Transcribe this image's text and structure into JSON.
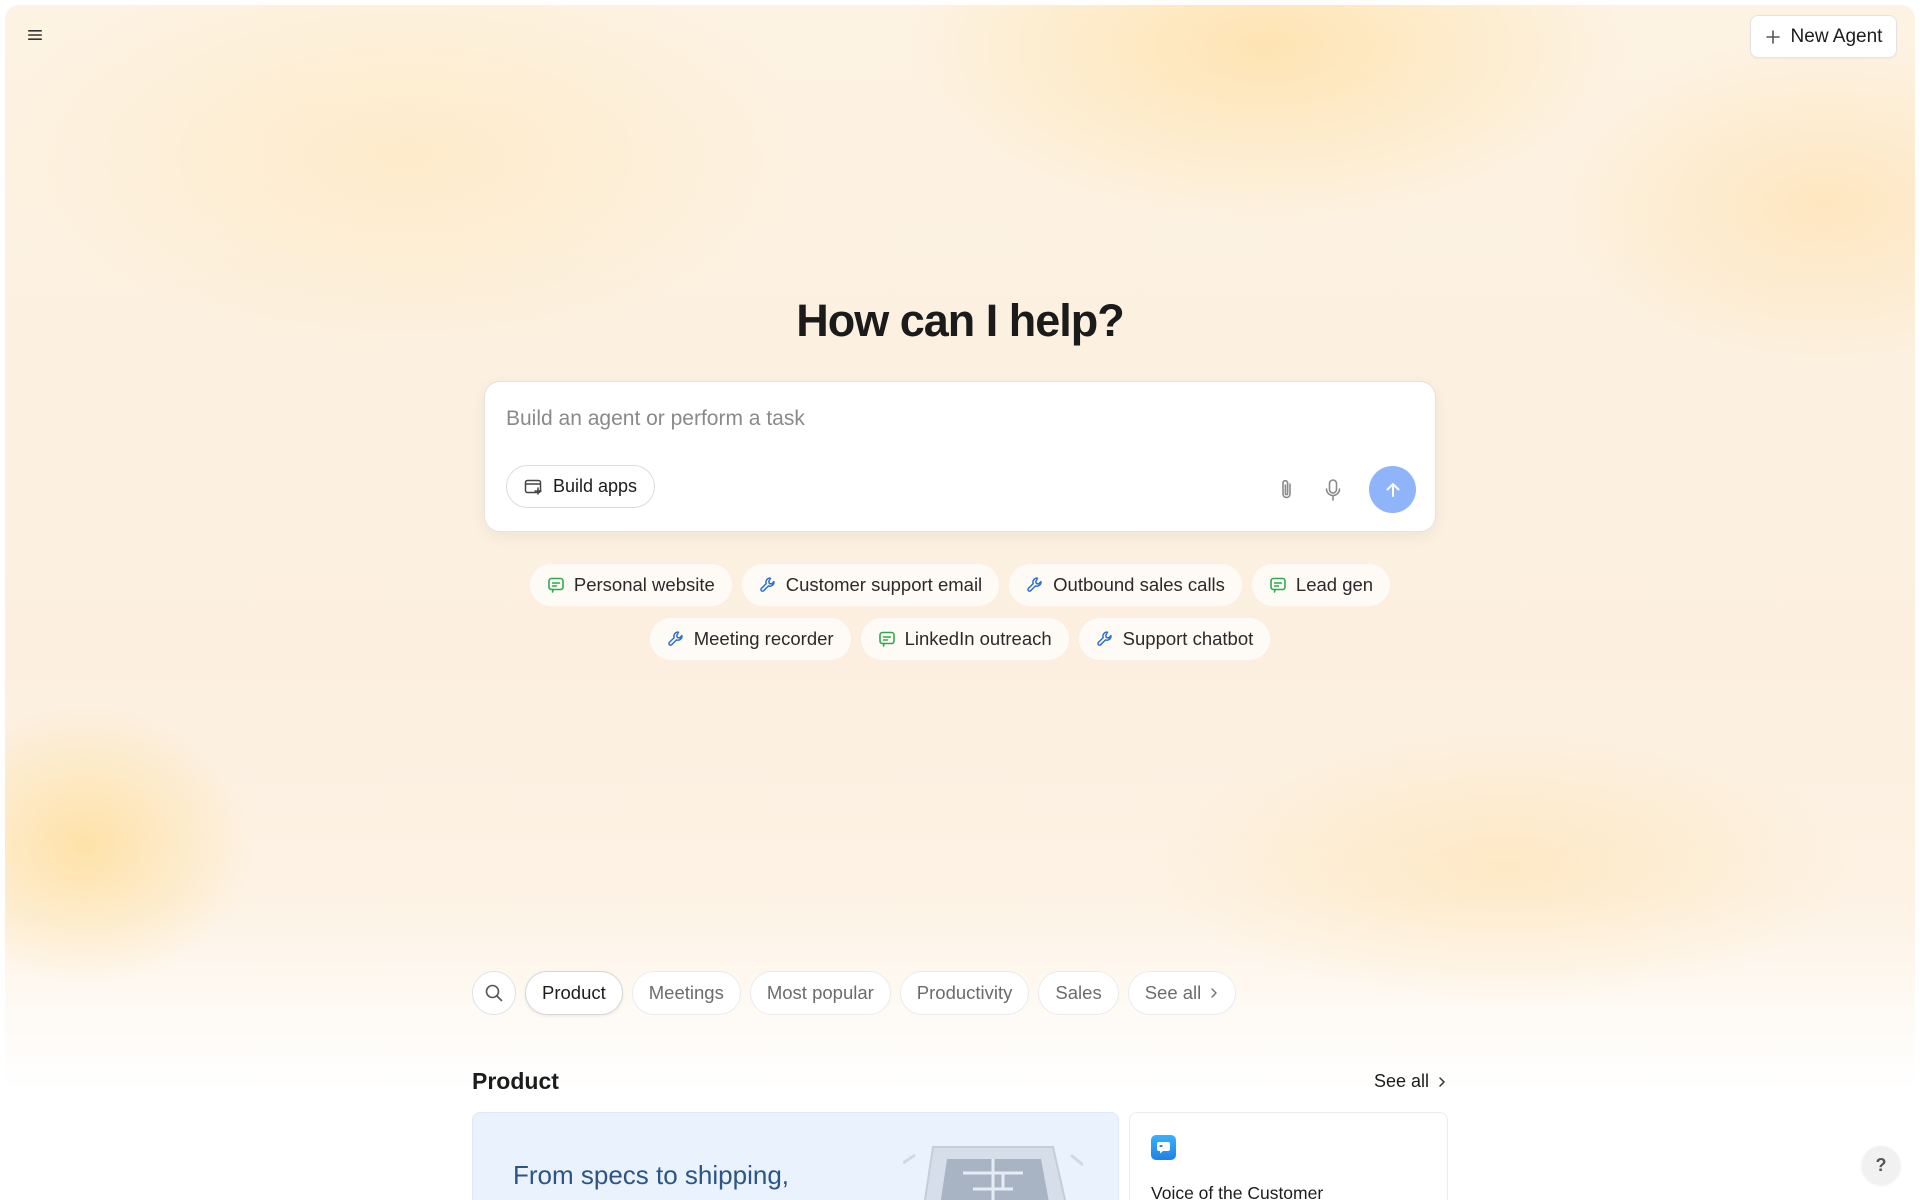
{
  "header": {
    "menu_icon": "hamburger-menu-icon",
    "new_agent_label": "New Agent",
    "new_agent_icon": "plus-icon"
  },
  "hero": {
    "title": "How can I help?"
  },
  "prompt": {
    "placeholder": "Build an agent or perform a task",
    "value": "",
    "build_apps_label": "Build apps",
    "build_apps_icon": "build-apps-icon",
    "attach_icon": "paperclip-icon",
    "mic_icon": "microphone-icon",
    "send_icon": "arrow-up-icon",
    "send_color": "#8fb4fa"
  },
  "suggestions": {
    "row1": [
      {
        "label": "Personal website",
        "icon": "chat-bubble-icon",
        "icon_color": "#2fa84f"
      },
      {
        "label": "Customer support email",
        "icon": "wrench-icon",
        "icon_color": "#2f6fd1"
      },
      {
        "label": "Outbound sales calls",
        "icon": "wrench-icon",
        "icon_color": "#2f6fd1"
      },
      {
        "label": "Lead gen",
        "icon": "chat-bubble-icon",
        "icon_color": "#2fa84f"
      }
    ],
    "row2": [
      {
        "label": "Meeting recorder",
        "icon": "wrench-icon",
        "icon_color": "#2f6fd1"
      },
      {
        "label": "LinkedIn outreach",
        "icon": "chat-bubble-icon",
        "icon_color": "#2fa84f"
      },
      {
        "label": "Support chatbot",
        "icon": "wrench-icon",
        "icon_color": "#2f6fd1"
      }
    ]
  },
  "filters": {
    "search_icon": "search-icon",
    "items": [
      {
        "label": "Product",
        "active": true
      },
      {
        "label": "Meetings",
        "active": false
      },
      {
        "label": "Most popular",
        "active": false
      },
      {
        "label": "Productivity",
        "active": false
      },
      {
        "label": "Sales",
        "active": false
      }
    ],
    "see_all_label": "See all"
  },
  "section": {
    "title": "Product",
    "see_all_label": "See all",
    "feature_card_text": "From specs to shipping,",
    "agent_card_title": "Voice of the Customer",
    "agent_card_icon": "chat-app-icon"
  },
  "help": {
    "label": "?"
  }
}
